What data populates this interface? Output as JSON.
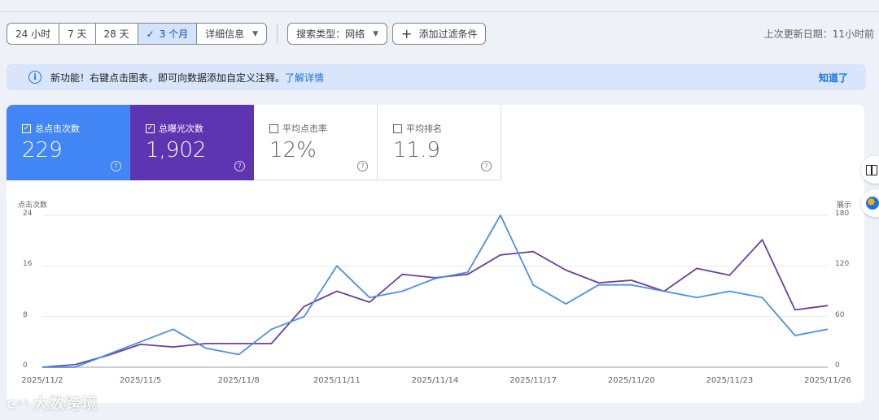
{
  "toolbar": {
    "ranges": [
      "24 小时",
      "7 天",
      "28 天",
      "3 个月"
    ],
    "active_range": "3 个月",
    "details_label": "详细信息",
    "search_type_label": "搜索类型：网络",
    "add_filter_label": "添加过滤条件",
    "updated_text": "上次更新日期：11小时前"
  },
  "banner": {
    "text": "新功能！右键点击图表，即可向数据添加自定义注释。",
    "link": "了解详情",
    "dismiss": "知道了"
  },
  "metrics": [
    {
      "label": "总点击次数",
      "value": "229",
      "checked": true
    },
    {
      "label": "总曝光次数",
      "value": "1,902",
      "checked": true
    },
    {
      "label": "平均点击率",
      "value": "12%",
      "checked": false
    },
    {
      "label": "平均排名",
      "value": "11.9",
      "checked": false
    }
  ],
  "chart_data": {
    "type": "line",
    "ylabel_left": "点击次数",
    "ylabel_right": "展示",
    "left_ticks": [
      "24",
      "16",
      "8",
      "0"
    ],
    "right_ticks": [
      "180",
      "120",
      "60",
      "0"
    ],
    "ylim_left": [
      0,
      24
    ],
    "ylim_right": [
      0,
      180
    ],
    "x_tick_labels": [
      "2025/11/2",
      "2025/11/5",
      "2025/11/8",
      "2025/11/11",
      "2025/11/14",
      "2025/11/17",
      "2025/11/20",
      "2025/11/23",
      "2025/11/26"
    ],
    "x": [
      "2025/11/2",
      "2025/11/3",
      "2025/11/4",
      "2025/11/5",
      "2025/11/6",
      "2025/11/7",
      "2025/11/8",
      "2025/11/9",
      "2025/11/10",
      "2025/11/11",
      "2025/11/12",
      "2025/11/13",
      "2025/11/14",
      "2025/11/15",
      "2025/11/16",
      "2025/11/17",
      "2025/11/18",
      "2025/11/19",
      "2025/11/20",
      "2025/11/21",
      "2025/11/22",
      "2025/11/23",
      "2025/11/24",
      "2025/11/25",
      "2025/11/26"
    ],
    "grid": true,
    "series": [
      {
        "name": "总点击次数",
        "axis": "left",
        "color": "#4a90e2",
        "values": [
          0,
          0,
          2,
          4,
          6,
          3,
          2,
          6,
          8,
          16,
          11,
          12,
          14,
          15,
          24,
          13,
          10,
          13,
          13,
          12,
          11,
          12,
          11,
          5,
          6
        ]
      },
      {
        "name": "总曝光次数",
        "axis": "right",
        "color": "#6b3fa0",
        "values": [
          0,
          3,
          14,
          27,
          24,
          28,
          28,
          28,
          72,
          90,
          77,
          110,
          106,
          110,
          133,
          137,
          115,
          100,
          103,
          90,
          117,
          109,
          151,
          68,
          73
        ]
      }
    ]
  },
  "watermark": "大数跨境"
}
